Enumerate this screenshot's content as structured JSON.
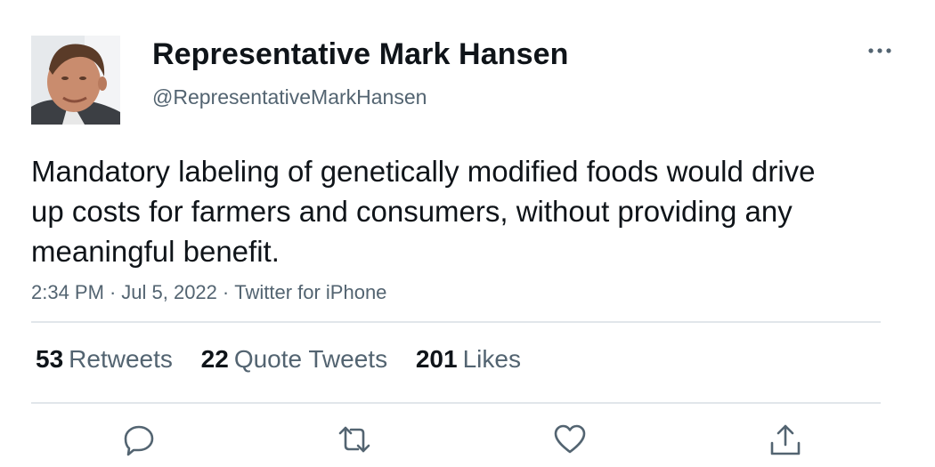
{
  "author": {
    "display_name": "Representative Mark Hansen",
    "handle": "@RepresentativeMarkHansen"
  },
  "tweet": {
    "text": "Mandatory labeling of genetically modified foods would drive up costs for farmers and consumers, without providing any meaningful benefit.",
    "time": "2:34 PM",
    "date": "Jul 5, 2022",
    "source": "Twitter for iPhone",
    "separator": "·"
  },
  "stats": {
    "retweets_count": "53",
    "retweets_label": "Retweets",
    "quotes_count": "22",
    "quotes_label": "Quote Tweets",
    "likes_count": "201",
    "likes_label": "Likes"
  },
  "actions": [
    "reply-icon",
    "retweet-icon",
    "like-icon",
    "share-icon"
  ],
  "more_icon": "more-horizontal-icon",
  "colors": {
    "text": "#0f1419",
    "secondary": "#536471",
    "divider": "#e1e6ea"
  }
}
